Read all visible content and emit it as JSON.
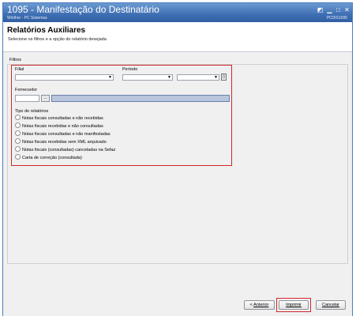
{
  "window": {
    "title": "1095 - Manifestação do Destinatário",
    "subtitle": "Winthor - PC Sistemas",
    "code": "PCDIS1095",
    "controls": [
      "restore-icon",
      "minimize-icon",
      "maximize-icon",
      "close-icon"
    ],
    "colors": {
      "titlebar": "#3f6fb3",
      "highlight": "#d0282a"
    }
  },
  "header": {
    "title": "Relatórios Auxiliares",
    "subtitle": "Selecione os filtros e a opção do relatório desejada"
  },
  "filters": {
    "group_label": "Filtros",
    "filial_label": "Filial",
    "periodo_label": "Período",
    "fornecedor_label": "Fornecedor",
    "fornecedor_button": "...",
    "tipo_label": "Tipo de relatórios",
    "report_types": [
      "Notas fiscais consultadas e não recebidas",
      "Notas fiscais recebidas e não consultadas",
      "Notas fiscais consultadas e não manifestadas",
      "Notas fiscais recebidas sem XML arquivado",
      "Notas fiscais (consultadas) canceladas na Sefaz",
      "Carta de correção (consultada)"
    ]
  },
  "footer": {
    "back_prefix": "< ",
    "back_label": "Anterior",
    "print_label": "Imprimir",
    "cancel_label": "Cancelar"
  }
}
